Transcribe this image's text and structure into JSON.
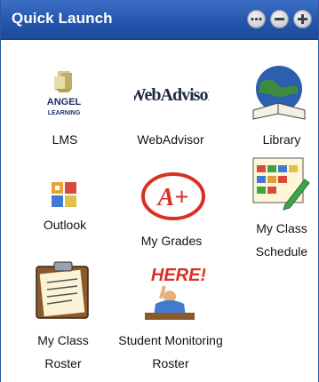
{
  "header": {
    "title": "Quick Launch",
    "controls": [
      "more-icon",
      "minimize-icon",
      "add-icon"
    ]
  },
  "launch_items": [
    {
      "id": "lms",
      "label_lines": [
        "LMS"
      ],
      "icon": "angel-learning-logo",
      "logo_text": [
        "ANGEL",
        "LEARNING"
      ]
    },
    {
      "id": "webadvisor",
      "label_lines": [
        "WebAdvisor"
      ],
      "icon": "webadvisor-logo",
      "logo_text": [
        "WebAdvisor"
      ]
    },
    {
      "id": "library",
      "label_lines": [
        "Library"
      ],
      "icon": "globe-book-icon"
    },
    {
      "id": "outlook",
      "label_lines": [
        "Outlook"
      ],
      "icon": "outlook-icon"
    },
    {
      "id": "my-grades",
      "label_lines": [
        "My Grades"
      ],
      "icon": "a-plus-grade-icon",
      "logo_text": [
        "A+"
      ]
    },
    {
      "id": "my-class-schedule",
      "label_lines": [
        "My Class",
        "Schedule"
      ],
      "icon": "calendar-pencil-icon"
    },
    {
      "id": "my-class-roster",
      "label_lines": [
        "My Class",
        "Roster"
      ],
      "icon": "clipboard-icon"
    },
    {
      "id": "student-monitoring-roster",
      "label_lines": [
        "Student Monitoring",
        "Roster"
      ],
      "icon": "here-sign-student-icon",
      "logo_text": [
        "HERE!"
      ]
    }
  ]
}
